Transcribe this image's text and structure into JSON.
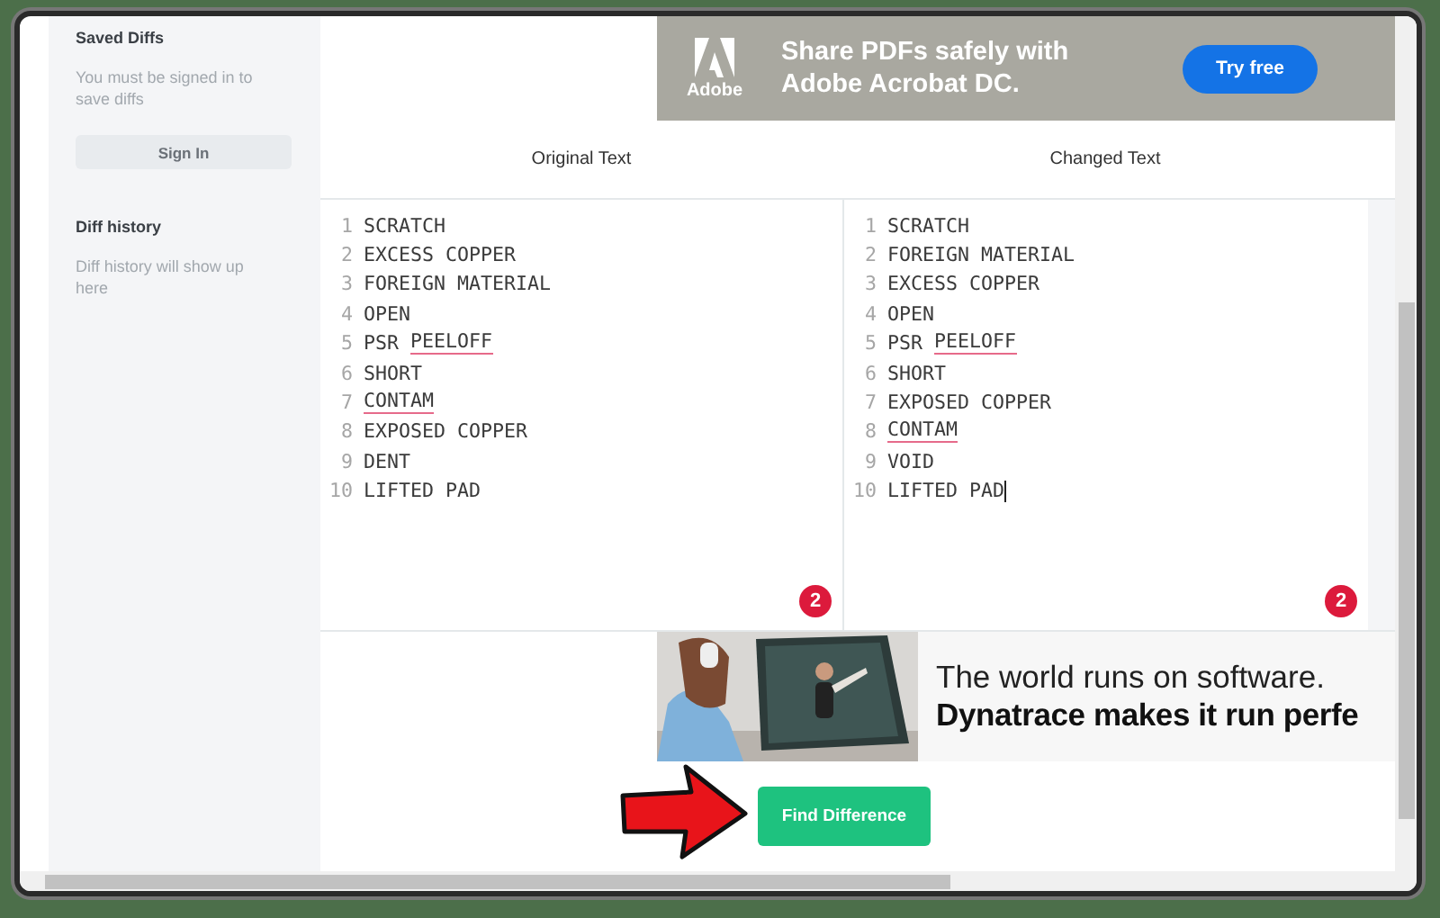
{
  "sidebar": {
    "saved_title": "Saved Diffs",
    "saved_note": "You must be signed in to save diffs",
    "sign_in": "Sign In",
    "history_title": "Diff history",
    "history_note": "Diff history will show up here"
  },
  "top_ad": {
    "brand": "Adobe",
    "headline": "Share PDFs safely with Adobe Acrobat DC.",
    "button": "Try free"
  },
  "editors": [
    {
      "title": "Original Text",
      "focused": false,
      "badge": "2",
      "lines": [
        {
          "number": "1",
          "parts": [
            {
              "text": "SCRATCH",
              "flagged": false
            }
          ]
        },
        {
          "number": "2",
          "parts": [
            {
              "text": "EXCESS COPPER",
              "flagged": false
            }
          ]
        },
        {
          "number": "3",
          "parts": [
            {
              "text": "FOREIGN MATERIAL",
              "flagged": false
            }
          ]
        },
        {
          "number": "4",
          "parts": [
            {
              "text": "OPEN",
              "flagged": false
            }
          ]
        },
        {
          "number": "5",
          "parts": [
            {
              "text": "PSR",
              "flagged": false
            },
            {
              "text": "PEELOFF",
              "flagged": true
            }
          ]
        },
        {
          "number": "6",
          "parts": [
            {
              "text": "SHORT",
              "flagged": false
            }
          ]
        },
        {
          "number": "7",
          "parts": [
            {
              "text": "CONTAM",
              "flagged": true
            }
          ]
        },
        {
          "number": "8",
          "parts": [
            {
              "text": "EXPOSED COPPER",
              "flagged": false
            }
          ]
        },
        {
          "number": "9",
          "parts": [
            {
              "text": "DENT",
              "flagged": false
            }
          ]
        },
        {
          "number": "10",
          "parts": [
            {
              "text": "LIFTED PAD",
              "flagged": false
            }
          ]
        }
      ]
    },
    {
      "title": "Changed Text",
      "focused": true,
      "badge": "2",
      "lines": [
        {
          "number": "1",
          "parts": [
            {
              "text": "SCRATCH",
              "flagged": false
            }
          ]
        },
        {
          "number": "2",
          "parts": [
            {
              "text": "FOREIGN MATERIAL",
              "flagged": false
            }
          ]
        },
        {
          "number": "3",
          "parts": [
            {
              "text": "EXCESS COPPER",
              "flagged": false
            }
          ]
        },
        {
          "number": "4",
          "parts": [
            {
              "text": "OPEN",
              "flagged": false
            }
          ]
        },
        {
          "number": "5",
          "parts": [
            {
              "text": "PSR",
              "flagged": false
            },
            {
              "text": "PEELOFF",
              "flagged": true
            }
          ]
        },
        {
          "number": "6",
          "parts": [
            {
              "text": "SHORT",
              "flagged": false
            }
          ]
        },
        {
          "number": "7",
          "parts": [
            {
              "text": "EXPOSED COPPER",
              "flagged": false
            }
          ]
        },
        {
          "number": "8",
          "parts": [
            {
              "text": "CONTAM",
              "flagged": true
            }
          ]
        },
        {
          "number": "9",
          "parts": [
            {
              "text": "VOID",
              "flagged": false
            }
          ]
        },
        {
          "number": "10",
          "parts": [
            {
              "text": "LIFTED PAD",
              "flagged": false
            }
          ]
        }
      ]
    }
  ],
  "bottom_ad": {
    "kind": "picture",
    "line_1": "The world runs on software.",
    "line_2": "Dynatrace makes it run perfe"
  },
  "find_button": "Find Difference"
}
